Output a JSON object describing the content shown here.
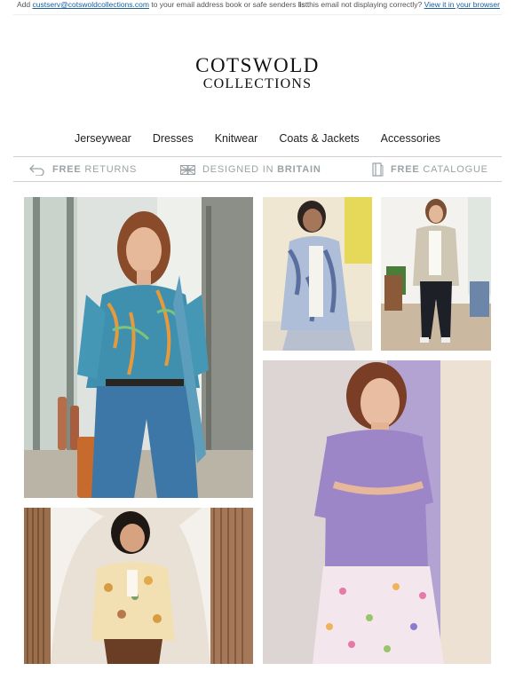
{
  "preheader": {
    "add_prefix": "Add",
    "email": "custserv@cotswoldcollections.com",
    "add_suffix": "to your email address book or safe senders list.",
    "display_text": "Is this email not displaying correctly?",
    "browser_link": "View it in your browser"
  },
  "brand": {
    "line1": "COTSWOLD",
    "line2": "COLLECTIONS"
  },
  "nav": {
    "items": [
      {
        "label": "Jerseywear"
      },
      {
        "label": "Dresses"
      },
      {
        "label": "Knitwear"
      },
      {
        "label": "Coats & Jackets"
      },
      {
        "label": "Accessories"
      }
    ]
  },
  "usp": {
    "returns": {
      "bold": "FREE",
      "rest": "RETURNS",
      "icon": "return-arrow-icon"
    },
    "britain": {
      "rest": "DESIGNED IN",
      "bold": "BRITAIN",
      "icon": "union-flag-icon"
    },
    "catalogue": {
      "bold": "FREE",
      "rest": "CATALOGUE",
      "icon": "catalogue-book-icon"
    }
  },
  "colors": {
    "link": "#1a5e9a",
    "usp_text": "#9aa3a6",
    "border": "#cfcfcf"
  }
}
